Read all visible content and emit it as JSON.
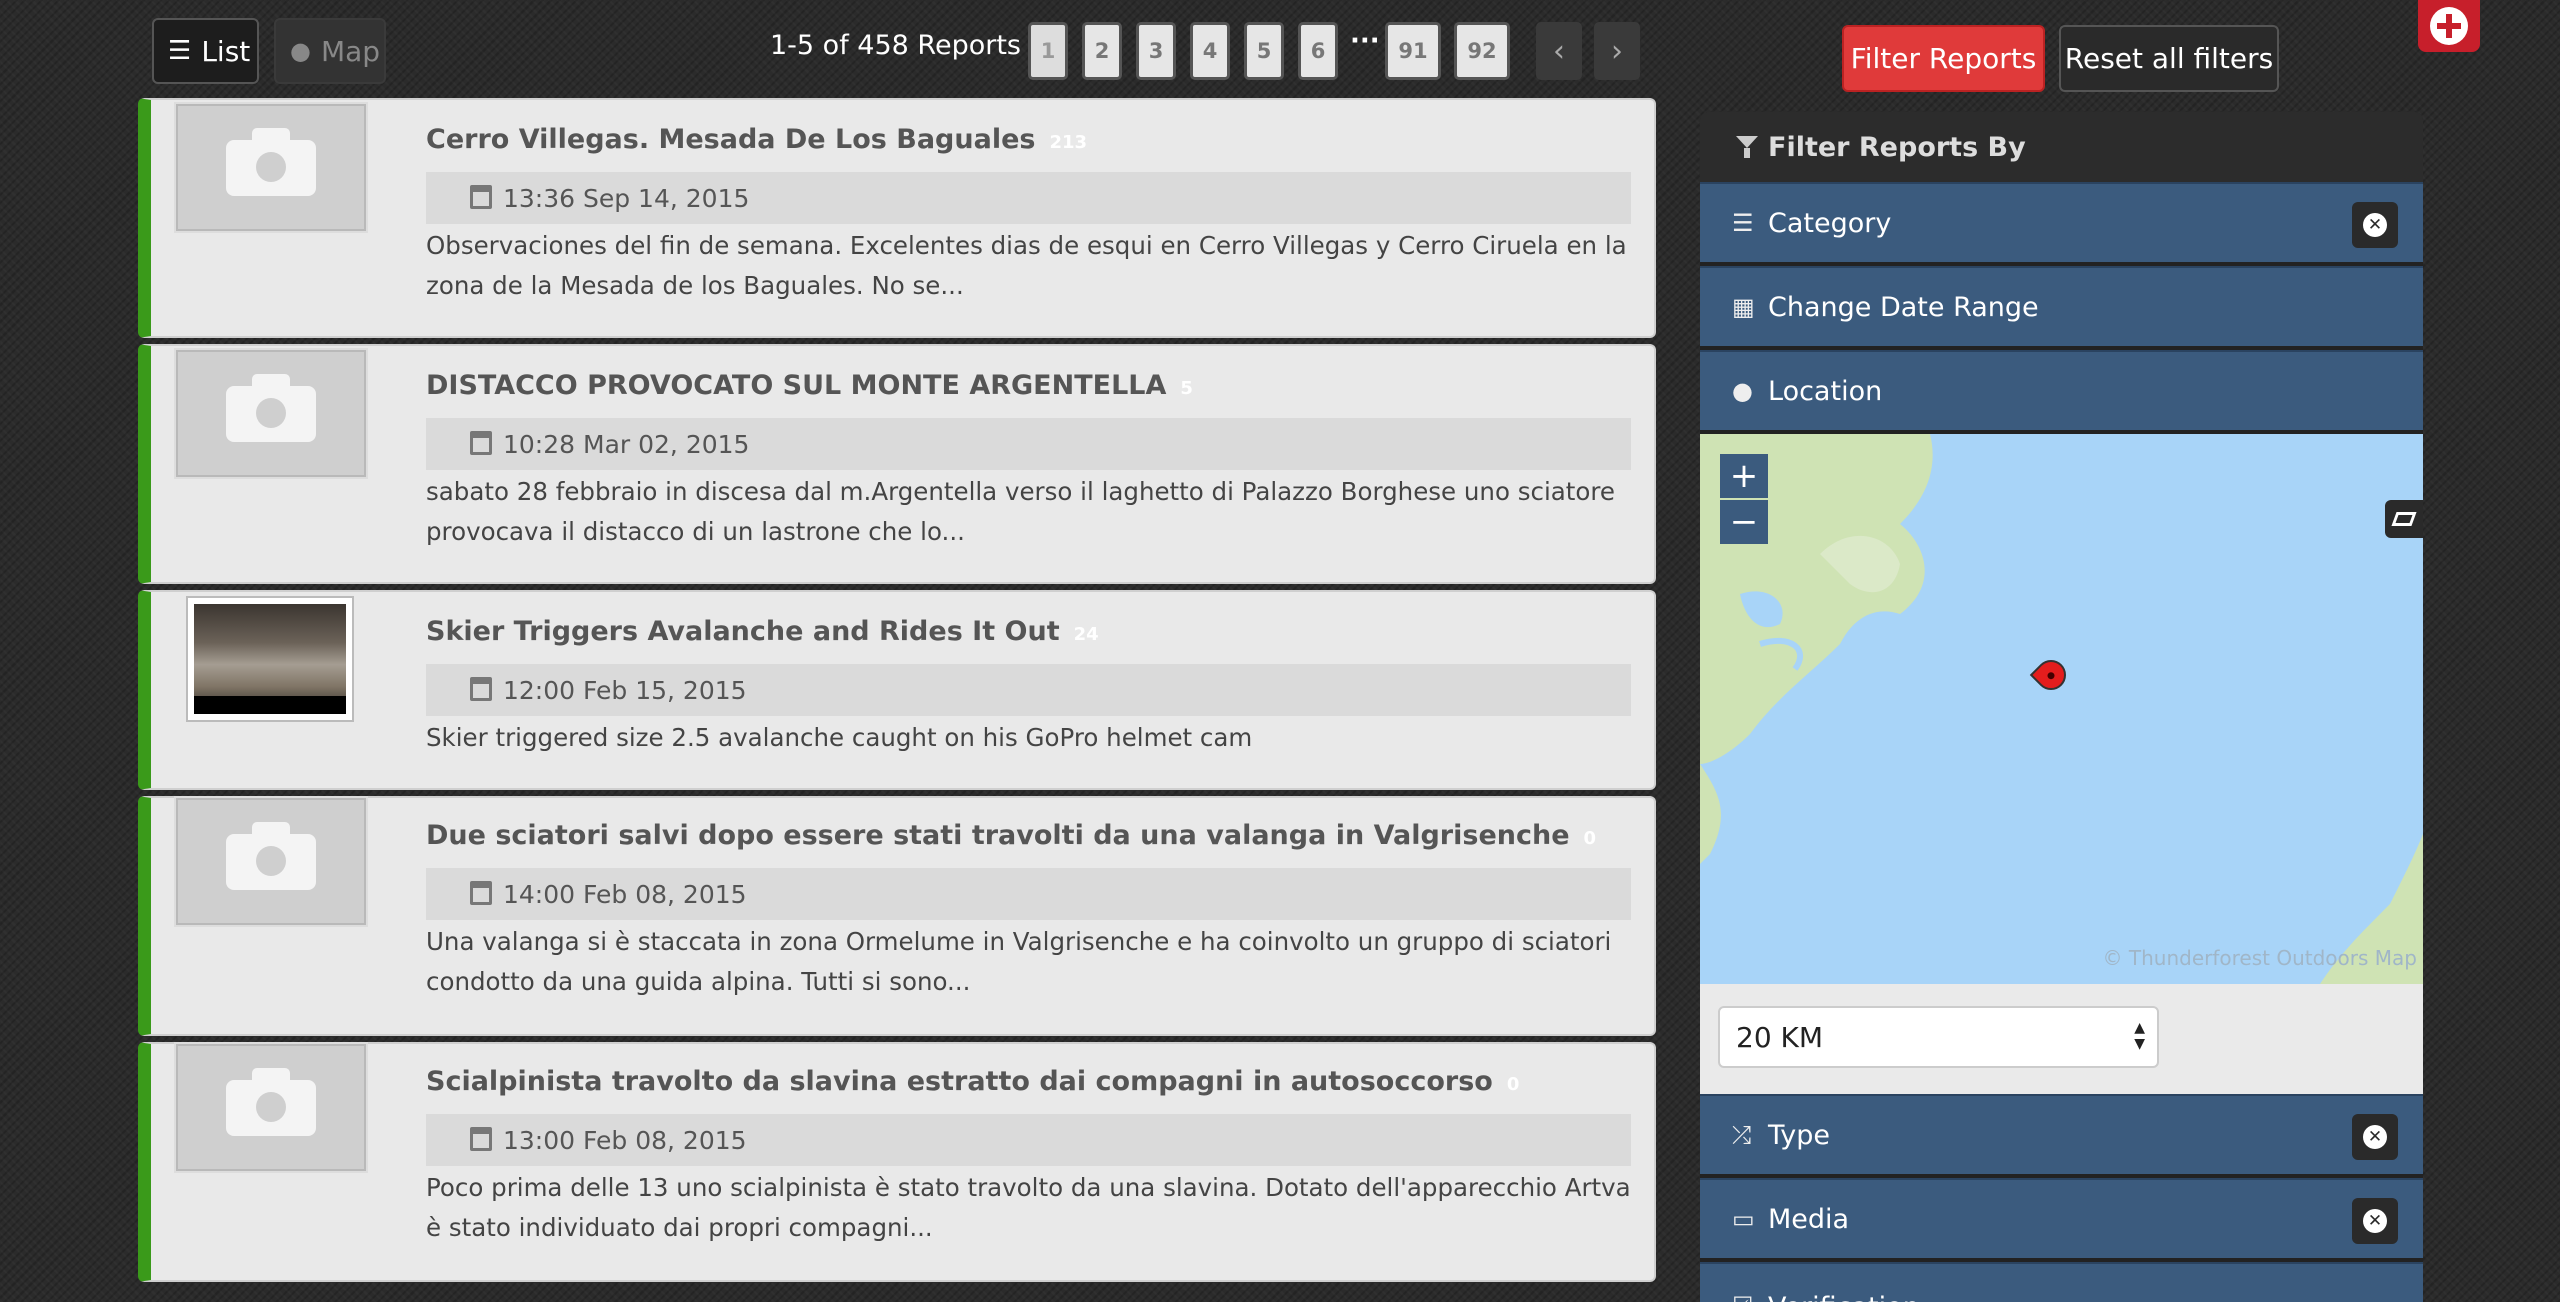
{
  "toolbar": {
    "list_label": "List",
    "map_label": "Map",
    "count": "1-5 of 458 Reports",
    "pages": [
      "1",
      "2",
      "3",
      "4",
      "5",
      "6",
      "91",
      "92"
    ],
    "ellipsis": "···",
    "prev": "‹",
    "next": "›"
  },
  "reports": [
    {
      "title": "Cerro Villegas. Mesada De Los Baguales",
      "comments": "213",
      "date": "13:36 Sep 14, 2015",
      "description": "Observaciones del fin de semana. Excelentes dias de esqui en Cerro Villegas y Cerro Ciruela en la zona de la Mesada de los Baguales. No se...",
      "media": "placeholder"
    },
    {
      "title": "DISTACCO PROVOCATO SUL MONTE ARGENTELLA",
      "comments": "5",
      "date": "10:28 Mar 02, 2015",
      "description": "sabato 28 febbraio in discesa dal m.Argentella verso il laghetto di Palazzo Borghese uno sciatore provocava il distacco di un lastrone che lo...",
      "media": "placeholder"
    },
    {
      "title": "Skier Triggers Avalanche and Rides It Out",
      "comments": "24",
      "date": "12:00 Feb 15, 2015",
      "description": "Skier triggered size 2.5 avalanche caught on his GoPro helmet cam",
      "media": "video"
    },
    {
      "title": "Due sciatori salvi dopo essere stati travolti da una valanga in Valgrisenche",
      "comments": "0",
      "date": "14:00 Feb 08, 2015",
      "description": "Una valanga si è staccata in zona Ormelume in Valgrisenche e ha coinvolto un gruppo di sciatori condotto da una guida alpina. Tutti si sono...",
      "media": "placeholder"
    },
    {
      "title": "Scialpinista travolto da slavina estratto dai compagni in autosoccorso",
      "comments": "0",
      "date": "13:00 Feb 08, 2015",
      "description": "Poco prima delle 13 uno scialpinista è stato travolto da una slavina. Dotato dell'apparecchio Artva è stato individuato dai propri compagni...",
      "media": "placeholder"
    }
  ],
  "filters": {
    "filter_button": "Filter Reports",
    "reset_button": "Reset all filters",
    "heading": "Filter Reports By",
    "sections": {
      "category": "Category",
      "date_range": "Change Date Range",
      "location": "Location",
      "type": "Type",
      "media": "Media",
      "verification": "Verification"
    },
    "map": {
      "zoom_in": "+",
      "zoom_out": "−",
      "attribution": "© Thunderforest Outdoors Map"
    },
    "radius": "20 KM"
  },
  "colors": {
    "accent_red": "#e03a3a",
    "section_blue": "#3b5b7e",
    "card_stripe_green": "#3a9a1a",
    "map_water": "#a8d4f8"
  },
  "icons": [
    "list-icon",
    "globe-icon",
    "calendar-icon",
    "camera-icon",
    "filter-icon",
    "shuffle-icon",
    "monitor-icon",
    "close-icon",
    "layers-icon",
    "map-marker-icon",
    "plus-icon"
  ]
}
